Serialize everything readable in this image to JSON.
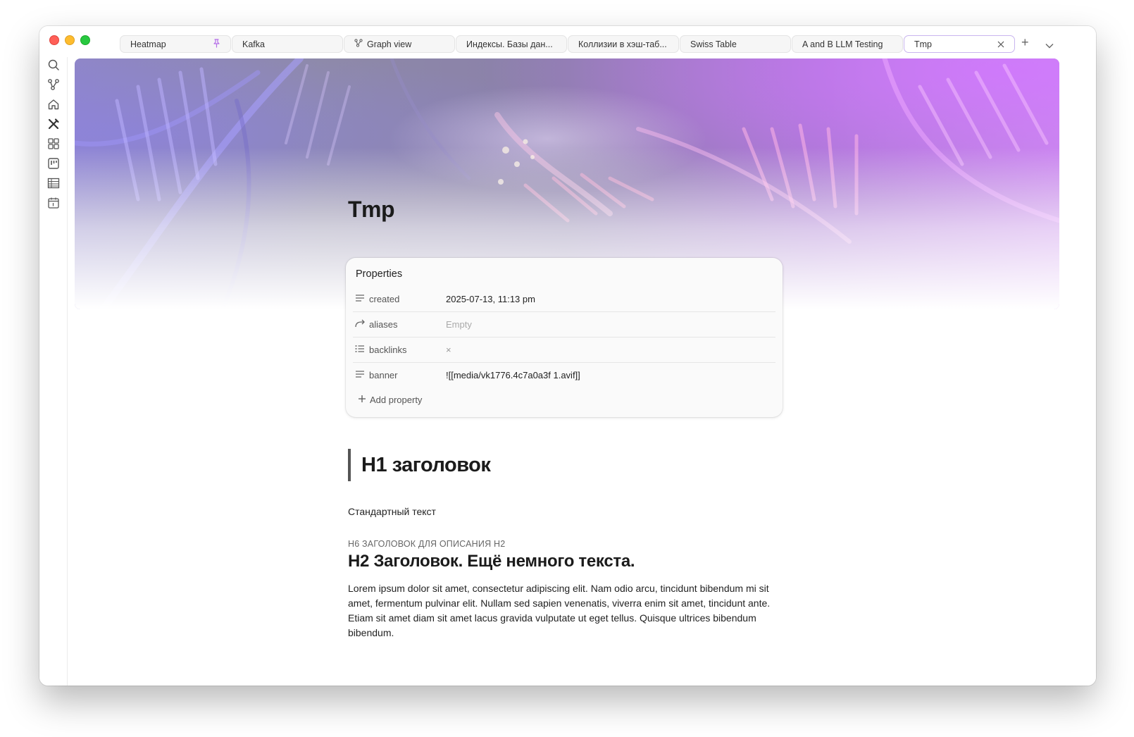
{
  "tabs": [
    {
      "label": "Heatmap",
      "icon": "pin-icon"
    },
    {
      "label": "Kafka"
    },
    {
      "label": "Graph view",
      "icon": "graph-icon"
    },
    {
      "label": "Индексы. Базы дан..."
    },
    {
      "label": "Коллизии в хэш-таб..."
    },
    {
      "label": "Swiss Table"
    },
    {
      "label": "A and B LLM Testing"
    },
    {
      "label": "Tmp",
      "active": true
    }
  ],
  "tabbar": {
    "new_tab": "+",
    "more": "⌄"
  },
  "ribbon": [
    "search-icon",
    "graph-icon",
    "home-icon",
    "tools-icon",
    "layout-icon",
    "kanban-icon",
    "table-icon",
    "calendar-icon"
  ],
  "note": {
    "title": "Tmp",
    "properties": {
      "heading": "Properties",
      "rows": [
        {
          "key": "created",
          "value": "2025-07-13, 11:13 pm",
          "icon": "text-lines-icon"
        },
        {
          "key": "aliases",
          "value": "Empty",
          "icon": "forward-arrow-icon"
        },
        {
          "key": "backlinks",
          "value": "×",
          "icon": "list-icon"
        },
        {
          "key": "banner",
          "value": "![[media/vk1776.4c7a0a3f 1.avif]]",
          "icon": "text-lines-icon"
        }
      ],
      "add_label": "Add property"
    },
    "h1": "H1 заголовок",
    "p1": "Стандартный текст",
    "h6": "H6 ЗАГОЛОВОК ДЛЯ ОПИСАНИЯ H2",
    "h2": "H2 Заголовок. Ещё немного текста.",
    "lorem": "Lorem ipsum dolor sit amet, consectetur adipiscing elit. Nam odio arcu, tincidunt bibendum mi sit amet, fermentum pulvinar elit. Nullam sed sapien venenatis, viverra enim sit amet, tincidunt ante. Etiam sit amet diam sit amet lacus gravida vulputate ut eget tellus. Quisque ultrices bibendum bibendum."
  },
  "colors": {
    "accent": "#b46ce8",
    "active_tab_border": "#c9b5ef"
  }
}
